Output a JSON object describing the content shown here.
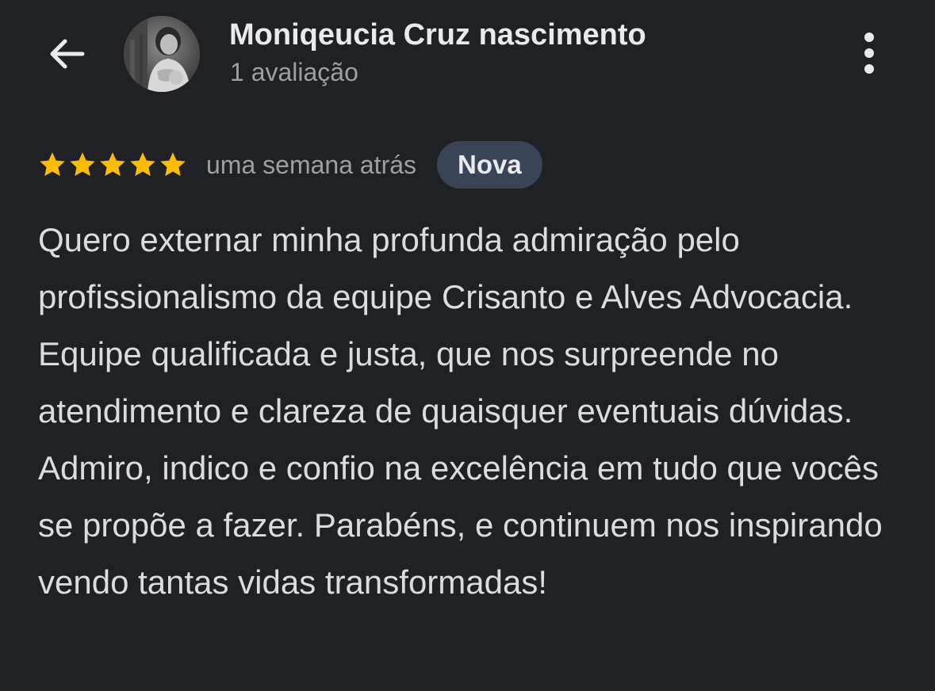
{
  "header": {
    "back_icon": "arrow-left-icon",
    "avatar_icon": "profile-photo",
    "reviewer_name": "Moniqeucia Cruz nascimento",
    "review_count": "1 avaliação",
    "more_icon": "more-vertical-icon"
  },
  "review": {
    "rating": 5,
    "rating_max": 5,
    "star_icon": "star-icon",
    "date": "uma semana atrás",
    "badge": "Nova",
    "text": "Quero externar minha profunda admiração pelo profissionalismo da equipe Crisanto e Alves Advocacia. Equipe qualificada e justa, que nos surpreende no atendimento e clareza de quaisquer eventuais dúvidas. Admiro, indico e confio na excelência em tudo que vocês se propõe a fazer. Parabéns, e continuem nos inspirando vendo tantas vidas transformadas!"
  },
  "colors": {
    "background": "#202124",
    "star": "#fbbc04",
    "badge_background": "#394457",
    "primary_text": "#e8eaed",
    "secondary_text": "#9aa0a6"
  }
}
